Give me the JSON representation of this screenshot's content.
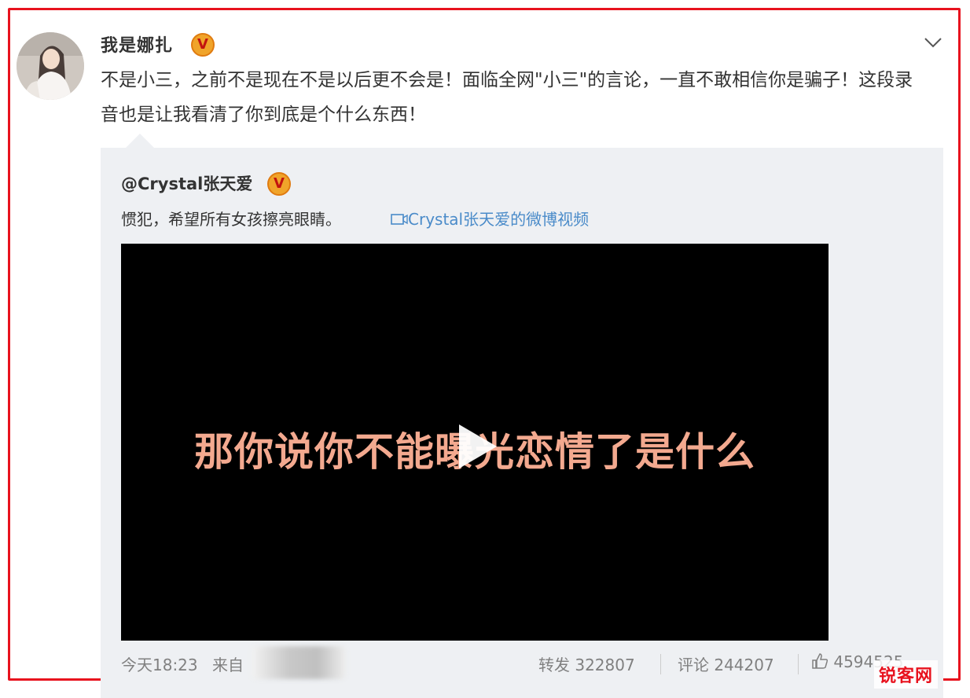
{
  "post": {
    "username": "我是娜扎",
    "verified_badge": "V",
    "text": "不是小三，之前不是现在不是以后更不会是！面临全网\"小三\"的言论，一直不敢相信你是骗子！这段录音也是让我看清了你到底是个什么东西！"
  },
  "quoted": {
    "username": "@Crystal张天爱",
    "verified_badge": "V",
    "text": "惯犯，希望所有女孩擦亮眼睛。",
    "video_link": "Crystal张天爱的微博视频",
    "video_subtitle": "那你说你不能曝光恋情了是什么"
  },
  "footer": {
    "time": "今天18:23",
    "source_label": "来自",
    "repost_label": "转发",
    "repost_count": "322807",
    "comment_label": "评论",
    "comment_count": "244207",
    "like_count": "4594525"
  },
  "watermark": "锐客网",
  "colors": {
    "frame": "#e8121e",
    "link": "#4a8bc9",
    "quote_bg": "#eef0f3",
    "subtitle": "#f3a98f"
  },
  "icons": [
    "avatar",
    "verified-badge-icon",
    "chevron-down-icon",
    "video-link-icon",
    "play-icon",
    "like-icon"
  ]
}
